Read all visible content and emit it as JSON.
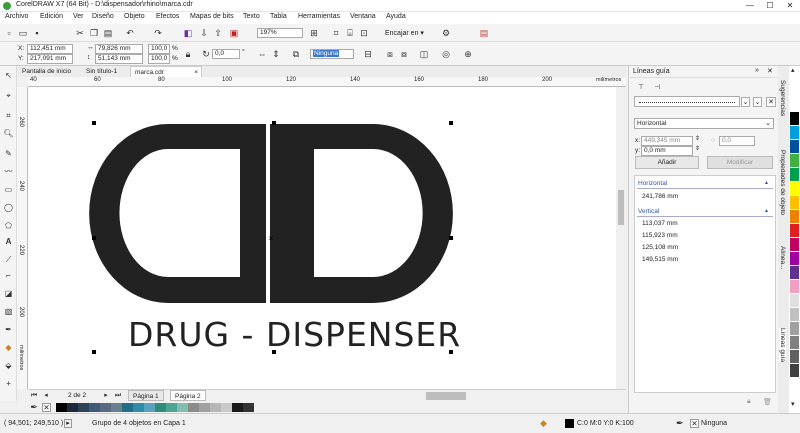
{
  "window": {
    "title": "CorelDRAW X7 (64 Bit) - D:\\dispensador\\rhino\\marca.cdr",
    "min": "—",
    "max": "☐",
    "close": "✕"
  },
  "menu": [
    "Archivo",
    "Edición",
    "Ver",
    "Diseño",
    "Objeto",
    "Efectos",
    "Mapas de bits",
    "Texto",
    "Tabla",
    "Herramientas",
    "Ventana",
    "Ayuda"
  ],
  "toolbar": {
    "zoom": "197%",
    "snap": "Encajar en",
    "snap_arrow": "▾"
  },
  "propbar": {
    "x": "112,451 mm",
    "y": "217,091 mm",
    "w": "79,826 mm",
    "h": "51,143 mm",
    "sx": "100,0",
    "sy": "100,0",
    "pct1": "%",
    "pct2": "%",
    "angle": "0,0",
    "deg": "°",
    "outline": "Ninguna"
  },
  "tabs": [
    "Pantalla de inicio",
    "Sin título-1",
    "marca.cdr"
  ],
  "tab_close": "×",
  "ruler": {
    "h": [
      "40",
      "60",
      "80",
      "100",
      "120",
      "140",
      "160",
      "180",
      "200"
    ],
    "h_unit": "milímetros",
    "v": [
      "260",
      "240",
      "220",
      "200"
    ],
    "v_unit": "milímetros"
  },
  "artwork": {
    "text": "DRUG - DISPENSER"
  },
  "pages": {
    "nav": "2 de 2",
    "tabs": [
      "Página 1",
      "Página 2"
    ]
  },
  "palette_colors": [
    "#000000",
    "#1b2a3c",
    "#2d4256",
    "#3e5b73",
    "#566b80",
    "#6a7f90",
    "#1f6f8b",
    "#2f8ca8",
    "#57a3bd",
    "#2d8c7c",
    "#4aa592",
    "#7fbfae",
    "#8a8a8a",
    "#a0a0a0",
    "#b7b7b7",
    "#c9c9c9",
    "#1a1a1a",
    "#333333"
  ],
  "status": {
    "coords": "( 94,501; 249,510 )",
    "object": "Grupo de 4 objetos en Capa 1",
    "fill": "C:0 M:0 Y:0 K:100",
    "outline": "Ninguna"
  },
  "docker": {
    "title": "Líneas guía",
    "section": "Horizontal",
    "x_val": "449,345 mm",
    "y_val": "0,0 mm",
    "angle": "0,0",
    "x_label": "x:",
    "y_label": "y:",
    "add": "Añadir",
    "modify": "Modificar",
    "list_h": "Horizontal",
    "h_items": [
      "241,786 mm"
    ],
    "list_v": "Vertical",
    "v_items": [
      "113,037 mm",
      "115,923 mm",
      "125,108 mm",
      "149,515 mm"
    ]
  },
  "docker_tabs": [
    "Sugerencias",
    "Propiedades de objeto",
    "Alinea...",
    "Líneas guía"
  ],
  "side_palette": [
    "#ffffff",
    "#000000",
    "#00a0e0",
    "#0050a0",
    "#40b040",
    "#00a050",
    "#ffff00",
    "#ffc000",
    "#f08000",
    "#e02020",
    "#c00060",
    "#a000a0",
    "#603090",
    "#f0a0c0",
    "#e0e0e0",
    "#c0c0c0",
    "#a0a0a0",
    "#808080",
    "#606060",
    "#404040"
  ]
}
